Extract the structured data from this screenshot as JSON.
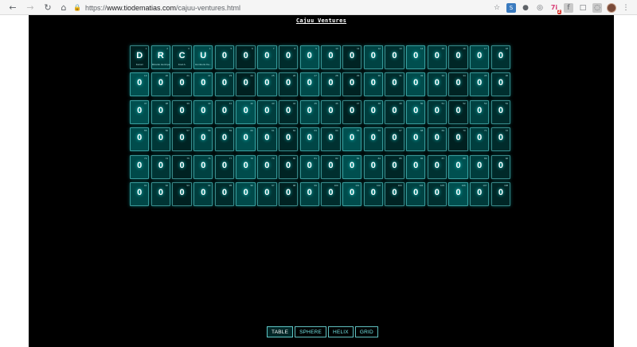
{
  "browser": {
    "url_scheme": "https://",
    "url_domain": "www.tiodematias.com",
    "url_path": "/cajuu-ventures.html",
    "toolbar_badge": "2"
  },
  "page": {
    "title": "Cajuu Ventures"
  },
  "menu": {
    "table": "TABLE",
    "sphere": "SPHERE",
    "helix": "HELIX",
    "grid": "GRID"
  },
  "elements": [
    {
      "symbol": "D",
      "detail": "Ferrari"
    },
    {
      "symbol": "R",
      "detail": "Ricardo Henrique"
    },
    {
      "symbol": "C",
      "detail": "Fred A."
    },
    {
      "symbol": "U",
      "detail": "Humberto Ka..."
    },
    {
      "symbol": "0"
    },
    {
      "symbol": "0"
    },
    {
      "symbol": "0"
    },
    {
      "symbol": "0"
    },
    {
      "symbol": "0"
    },
    {
      "symbol": "0"
    },
    {
      "symbol": "0"
    },
    {
      "symbol": "0"
    },
    {
      "symbol": "0"
    },
    {
      "symbol": "0"
    },
    {
      "symbol": "0"
    },
    {
      "symbol": "0"
    },
    {
      "symbol": "0"
    },
    {
      "symbol": "0"
    },
    {
      "symbol": "0"
    },
    {
      "symbol": "0"
    },
    {
      "symbol": "0"
    },
    {
      "symbol": "0"
    },
    {
      "symbol": "0"
    },
    {
      "symbol": "0"
    },
    {
      "symbol": "0"
    },
    {
      "symbol": "0"
    },
    {
      "symbol": "0"
    },
    {
      "symbol": "0"
    },
    {
      "symbol": "0"
    },
    {
      "symbol": "0"
    },
    {
      "symbol": "0"
    },
    {
      "symbol": "0"
    },
    {
      "symbol": "0"
    },
    {
      "symbol": "0"
    },
    {
      "symbol": "0"
    },
    {
      "symbol": "0"
    },
    {
      "symbol": "0"
    },
    {
      "symbol": "0"
    },
    {
      "symbol": "0"
    },
    {
      "symbol": "0"
    },
    {
      "symbol": "0"
    },
    {
      "symbol": "0"
    },
    {
      "symbol": "0"
    },
    {
      "symbol": "0"
    },
    {
      "symbol": "0"
    },
    {
      "symbol": "0"
    },
    {
      "symbol": "0"
    },
    {
      "symbol": "0"
    },
    {
      "symbol": "0"
    },
    {
      "symbol": "0"
    },
    {
      "symbol": "0"
    },
    {
      "symbol": "0"
    },
    {
      "symbol": "0"
    },
    {
      "symbol": "0"
    },
    {
      "symbol": "0"
    },
    {
      "symbol": "0"
    },
    {
      "symbol": "0"
    },
    {
      "symbol": "0"
    },
    {
      "symbol": "0"
    },
    {
      "symbol": "0"
    },
    {
      "symbol": "0"
    },
    {
      "symbol": "0"
    },
    {
      "symbol": "0"
    },
    {
      "symbol": "0"
    },
    {
      "symbol": "0"
    },
    {
      "symbol": "0"
    },
    {
      "symbol": "0"
    },
    {
      "symbol": "0"
    },
    {
      "symbol": "0"
    },
    {
      "symbol": "0"
    },
    {
      "symbol": "0"
    },
    {
      "symbol": "0"
    },
    {
      "symbol": "0"
    },
    {
      "symbol": "0"
    },
    {
      "symbol": "0"
    },
    {
      "symbol": "0"
    },
    {
      "symbol": "0"
    },
    {
      "symbol": "0"
    },
    {
      "symbol": "0"
    },
    {
      "symbol": "0"
    },
    {
      "symbol": "0"
    },
    {
      "symbol": "0"
    },
    {
      "symbol": "0"
    },
    {
      "symbol": "0"
    },
    {
      "symbol": "0"
    },
    {
      "symbol": "0"
    },
    {
      "symbol": "0"
    },
    {
      "symbol": "0"
    },
    {
      "symbol": "0"
    },
    {
      "symbol": "0"
    },
    {
      "symbol": "0"
    },
    {
      "symbol": "0"
    },
    {
      "symbol": "0"
    },
    {
      "symbol": "0"
    },
    {
      "symbol": "0"
    },
    {
      "symbol": "0"
    },
    {
      "symbol": "0"
    },
    {
      "symbol": "0"
    },
    {
      "symbol": "0"
    },
    {
      "symbol": "0"
    },
    {
      "symbol": "0"
    },
    {
      "symbol": "0"
    },
    {
      "symbol": "0"
    },
    {
      "symbol": "0"
    },
    {
      "symbol": "0"
    },
    {
      "symbol": "0"
    },
    {
      "symbol": "0"
    },
    {
      "symbol": "0"
    }
  ],
  "colors": {
    "page_background": "#000000",
    "tile_glow": "#00ffff",
    "menu_border": "#7fffff"
  }
}
